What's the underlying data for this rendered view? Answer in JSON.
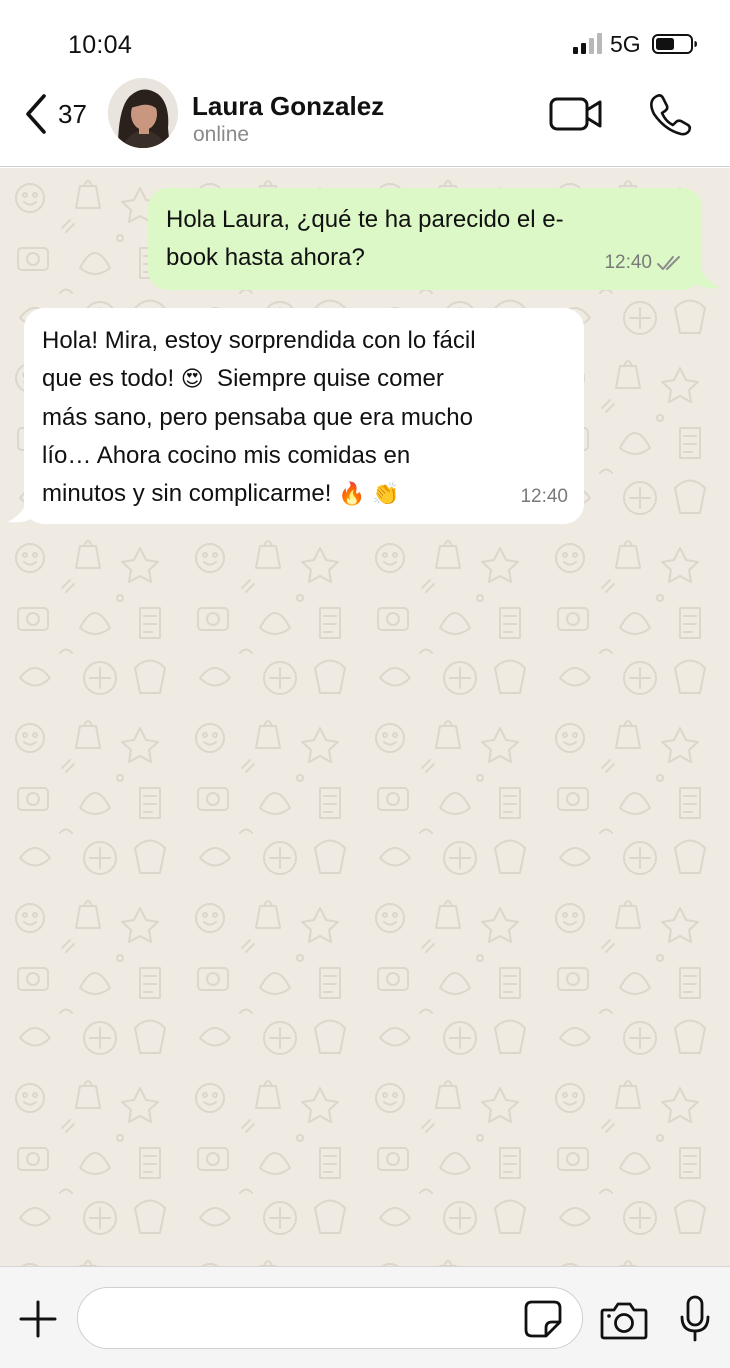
{
  "status_bar": {
    "time": "10:04",
    "network": "5G",
    "icons": [
      "signal-icon",
      "battery-icon"
    ]
  },
  "header": {
    "back_count": "37",
    "contact_name": "Laura Gonzalez",
    "contact_status": "online",
    "icons": [
      "chevron-left-icon",
      "video-call-icon",
      "phone-icon"
    ]
  },
  "chat": {
    "messages": [
      {
        "direction": "outgoing",
        "lines": [
          "Hola Laura, ¿qué te ha parecido el e-",
          "book hasta ahora?"
        ],
        "time": "12:40",
        "status": "read"
      },
      {
        "direction": "incoming",
        "line1": "Hola! Mira, estoy sorprendida con lo fácil",
        "line2_text": "que es todo! ",
        "line2_emoji": "😍",
        "line2_rest": "  Siempre quise comer",
        "line3": "más sano, pero pensaba que era mucho",
        "line4": "lío… Ahora cocino mis comidas en",
        "line5_text": "minutos y sin complicarme! ",
        "line5_emoji1": "🔥",
        "line5_emoji2": "👏",
        "time": "12:40"
      }
    ]
  },
  "composer": {
    "input_value": "",
    "icons": [
      "plus-icon",
      "sticker-icon",
      "camera-icon",
      "microphone-icon"
    ]
  },
  "colors": {
    "outgoing_bubble": "#dcf8c6",
    "incoming_bubble": "#ffffff",
    "chat_background": "#efeae2",
    "read_ticks": "#8c8c8c"
  }
}
